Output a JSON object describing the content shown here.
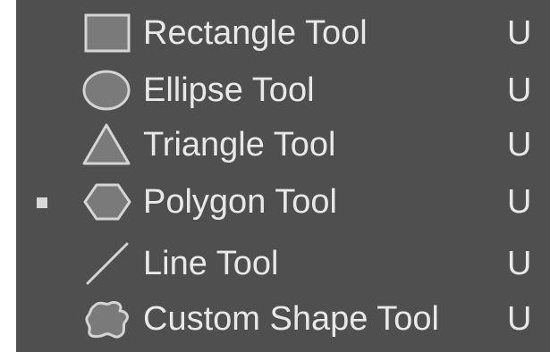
{
  "menu": {
    "items": [
      {
        "label": "Rectangle Tool",
        "shortcut": "U",
        "icon": "rectangle-icon",
        "active": false
      },
      {
        "label": "Ellipse Tool",
        "shortcut": "U",
        "icon": "ellipse-icon",
        "active": false
      },
      {
        "label": "Triangle Tool",
        "shortcut": "U",
        "icon": "triangle-icon",
        "active": false
      },
      {
        "label": "Polygon Tool",
        "shortcut": "U",
        "icon": "polygon-icon",
        "active": true
      },
      {
        "label": "Line Tool",
        "shortcut": "U",
        "icon": "line-icon",
        "active": false
      },
      {
        "label": "Custom Shape Tool",
        "shortcut": "U",
        "icon": "custom-shape-icon",
        "active": false
      }
    ]
  },
  "colors": {
    "panel_background": "#4f4f4f",
    "text": "#e8e8e8",
    "icon_fill": "#7a7a7a",
    "icon_stroke": "#d4d4d4",
    "active_marker": "#d8d8d8"
  }
}
